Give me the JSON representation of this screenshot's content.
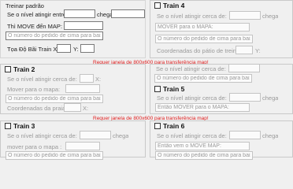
{
  "training": {
    "title": "Treinar padrão",
    "level_label": "Se o nível atingir entre:",
    "level_mid": "chega",
    "move_label": "Thì MOVE đến MAP:",
    "order_placeholder": "O número do pedido de cima para baixo do M",
    "coord_label": "Tọa Độ Bãi Train X:",
    "coord_y": "Y:"
  },
  "warning": "Requer janela de 800x600 para transferência map!",
  "train2": {
    "title": "Train 2",
    "level_label": "Se o nível atingir cerca de:",
    "level_mid": "X:",
    "move_label": "Mover para o mapa:",
    "order_placeholder": "O número do pedido de cima para baixo do M",
    "coord_label": "Coordenadas da praia Train",
    "coord_x": "X:"
  },
  "train3": {
    "title": "Train 3",
    "level_label": "Se o nível atingir cerca de:",
    "level_mid": "chega",
    "move_label": "mover para o mapa :",
    "order_placeholder": "O número do pedido de cima para baixo do M"
  },
  "train4": {
    "title": "Train 4",
    "level_label": "Se o nível atingir cerca de:",
    "level_mid": "chega",
    "move_placeholder": "MOVER para o MAPA:",
    "order_placeholder": "O número do pedido de cima para baixo do M",
    "coord_label": "Coordenadas do pátio de treino :",
    "coord_x": "Y:"
  },
  "train5": {
    "title": "Train 5",
    "level_label": "Se o nível atingir cerca de:",
    "level_mid": "chega",
    "move_placeholder": "Então MOVER para o MAPA:",
    "order_placeholder": "O número do pedido de cima para baixo do M",
    "coord_label": "Tọa Độ Bãi Train X:"
  },
  "train6": {
    "title": "Train 6",
    "level_label": "Se o nível atingir cerca de:",
    "level_mid": "chega",
    "move_placeholder": "Então vem o MOVE MAP:",
    "order_placeholder": "O número do pedido de cima para baixo do M"
  }
}
